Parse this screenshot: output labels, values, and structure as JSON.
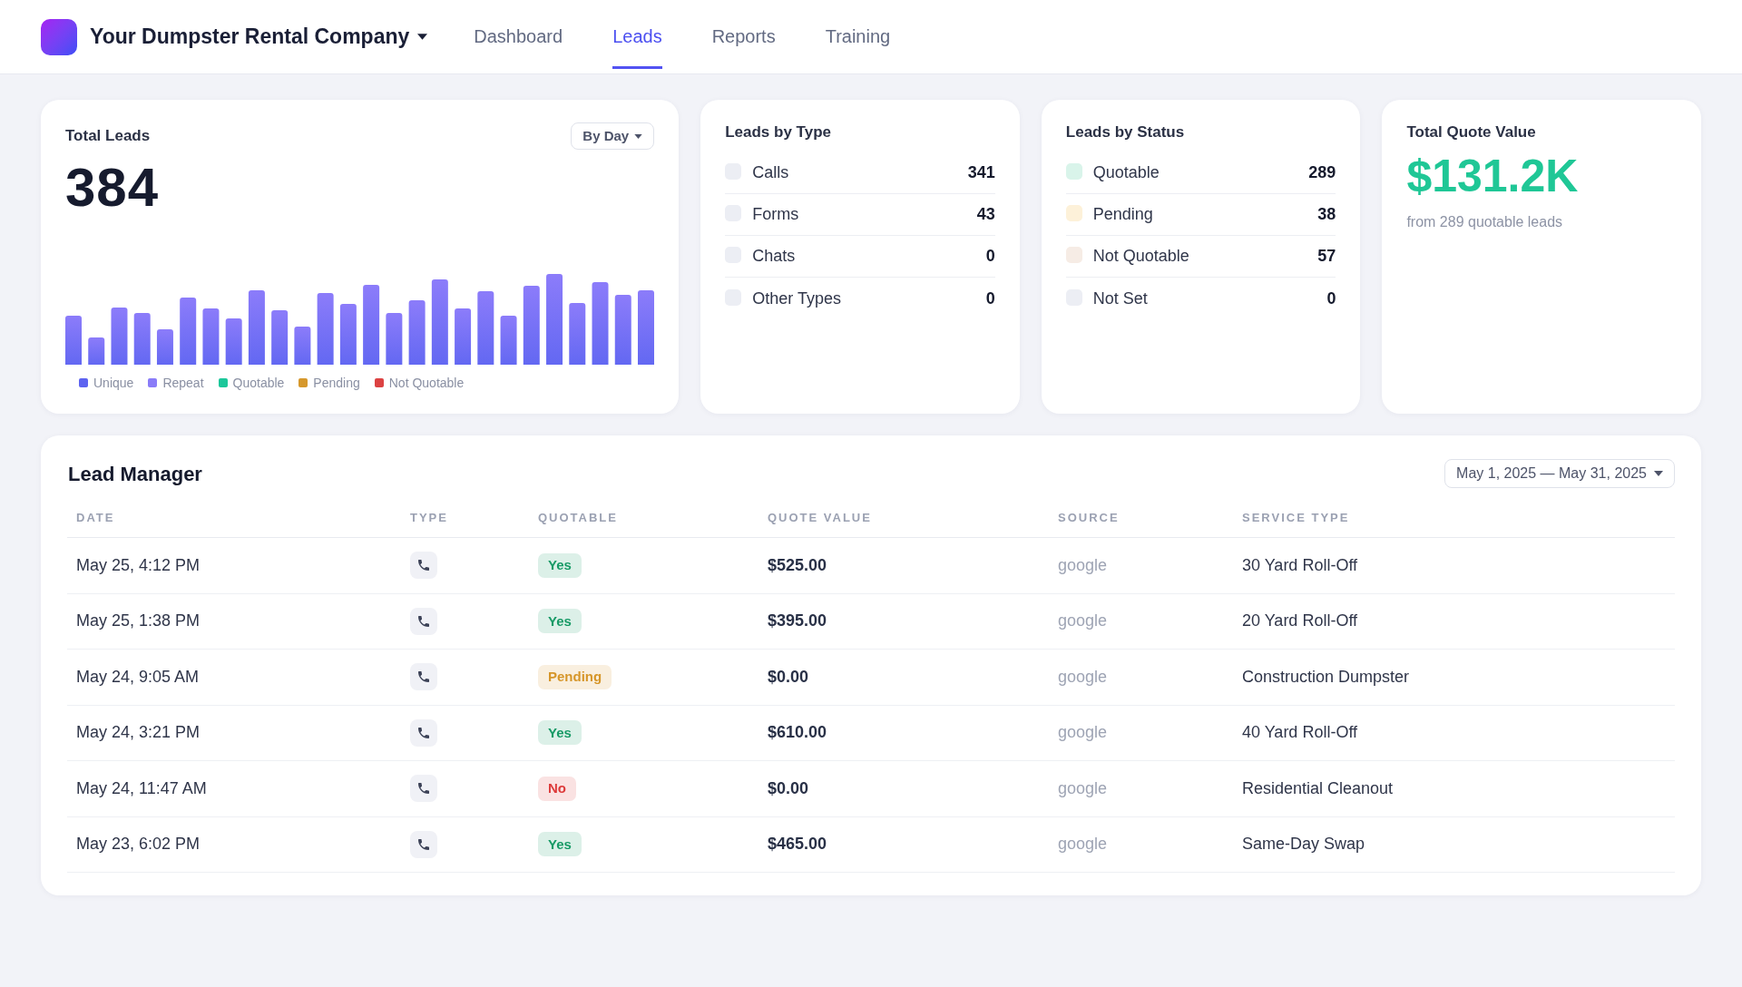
{
  "header": {
    "company": "Your Dumpster Rental Company",
    "nav": [
      {
        "label": "Dashboard",
        "selected": false
      },
      {
        "label": "Leads",
        "selected": true
      },
      {
        "label": "Reports",
        "selected": false
      },
      {
        "label": "Training",
        "selected": false
      }
    ]
  },
  "total_leads": {
    "title": "Total Leads",
    "period": "By Day",
    "value": "384",
    "legend": [
      {
        "label": "Unique",
        "color": "#5d63f0"
      },
      {
        "label": "Repeat",
        "color": "#8a7cf8"
      },
      {
        "label": "Quotable",
        "color": "#1cc79a"
      },
      {
        "label": "Pending",
        "color": "#d6982c"
      },
      {
        "label": "Not Quotable",
        "color": "#dc4242"
      }
    ]
  },
  "leads_by_type": {
    "title": "Leads by Type",
    "items": [
      {
        "label": "Calls",
        "value": "341"
      },
      {
        "label": "Forms",
        "value": "43"
      },
      {
        "label": "Chats",
        "value": "0"
      },
      {
        "label": "Other Types",
        "value": "0"
      }
    ]
  },
  "leads_by_status": {
    "title": "Leads by Status",
    "items": [
      {
        "label": "Quotable",
        "value": "289",
        "color": "#d9f4ea"
      },
      {
        "label": "Pending",
        "value": "38",
        "color": "#fdf1d9"
      },
      {
        "label": "Not Quotable",
        "value": "57",
        "color": "#f6ece5"
      },
      {
        "label": "Not Set",
        "value": "0",
        "color": "#eceef4"
      }
    ]
  },
  "total_quote_value": {
    "title": "Total Quote Value",
    "value": "$131.2K",
    "caption": "from 289 quotable leads"
  },
  "lead_manager": {
    "title": "Lead Manager",
    "date_range": "May 1, 2025 — May 31, 2025",
    "columns": [
      "DATE",
      "TYPE",
      "QUOTABLE",
      "QUOTE VALUE",
      "SOURCE",
      "SERVICE TYPE"
    ],
    "rows": [
      {
        "date": "May 25, 4:12 PM",
        "quotable": {
          "label": "Yes",
          "color": "#179a66"
        },
        "quote_value": "$525.00",
        "source": "google",
        "service_type": "30 Yard Roll-Off"
      },
      {
        "date": "May 25, 1:38 PM",
        "quotable": {
          "label": "Yes",
          "color": "#179a66"
        },
        "quote_value": "$395.00",
        "source": "google",
        "service_type": "20 Yard Roll-Off"
      },
      {
        "date": "May 24, 9:05 AM",
        "quotable": {
          "label": "Pending",
          "color": "#d6962a"
        },
        "quote_value": "$0.00",
        "source": "google",
        "service_type": "Construction Dumpster"
      },
      {
        "date": "May 24, 3:21 PM",
        "quotable": {
          "label": "Yes",
          "color": "#179a66"
        },
        "quote_value": "$610.00",
        "source": "google",
        "service_type": "40 Yard Roll-Off"
      },
      {
        "date": "May 24, 11:47 AM",
        "quotable": {
          "label": "No",
          "color": "#dd3b3b"
        },
        "quote_value": "$0.00",
        "source": "google",
        "service_type": "Residential Cleanout"
      },
      {
        "date": "May 23, 6:02 PM",
        "quotable": {
          "label": "Yes",
          "color": "#179a66"
        },
        "quote_value": "$465.00",
        "source": "google",
        "service_type": "Same-Day Swap"
      }
    ]
  }
}
